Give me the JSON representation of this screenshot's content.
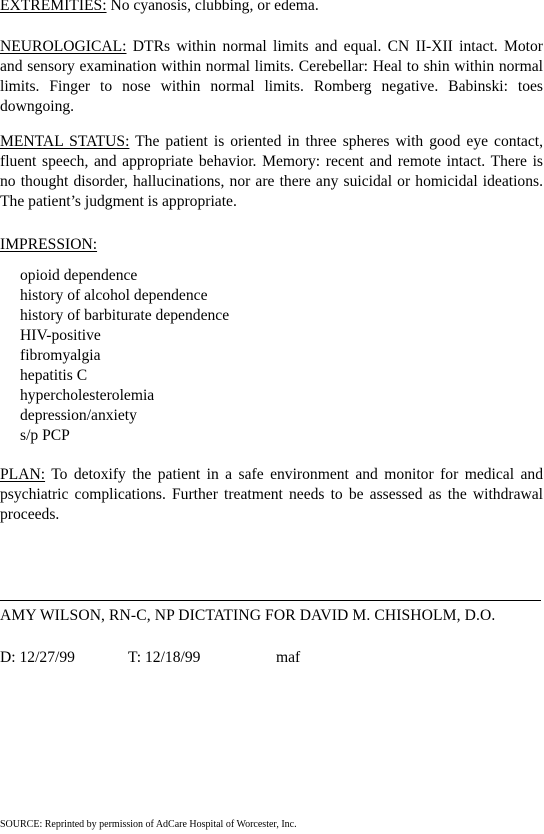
{
  "extremities": {
    "heading": "EXTREMITIES:",
    "text": " No cyanosis, clubbing, or edema."
  },
  "neurological": {
    "heading": "NEUROLOGICAL:",
    "text": " DTRs within normal limits and equal. CN II-XII intact. Motor and sensory examination within normal limits. Cerebellar: Heal to shin within normal limits. Finger to nose within normal limits. Romberg negative. Babinski: toes downgoing."
  },
  "mental_status": {
    "heading": "MENTAL STATUS:",
    "text": " The patient is oriented in three spheres with good eye contact, fluent speech, and appropriate behavior. Memory: recent and remote intact. There is no thought disorder, hallucinations, nor are there any suicidal or homicidal ideations. The patient’s judgment is appropriate."
  },
  "impression": {
    "heading": "IMPRESSION:",
    "items": [
      "opioid dependence",
      "history of alcohol dependence",
      "history of barbiturate dependence",
      "HIV-positive",
      "fibromyalgia",
      "hepatitis C",
      "hypercholesterolemia",
      "depression/anxiety",
      "s/p PCP"
    ]
  },
  "plan": {
    "heading": "PLAN:",
    "text": " To detoxify the patient in a safe environment and monitor for medical and psychiatric complications. Further treatment needs to be assessed as the withdrawal proceeds."
  },
  "signature": {
    "name": "AMY WILSON, RN-C, NP DICTATING FOR DAVID M. CHISHOLM, D.O."
  },
  "dates": {
    "dictated": "D:  12/27/99",
    "transcribed": "T:  12/18/99",
    "initials": "maf"
  },
  "source": "SOURCE: Reprinted by permission of AdCare Hospital of Worcester, Inc."
}
